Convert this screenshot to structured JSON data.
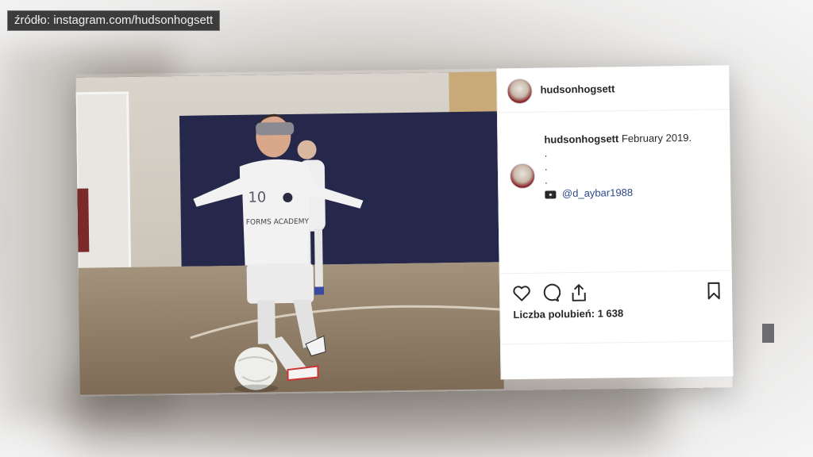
{
  "overlay": {
    "source_label": "źródło: instagram.com/hudsonhogsett"
  },
  "post": {
    "header": {
      "username": "hudsonhogsett"
    },
    "caption": {
      "username": "hudsonhogsett",
      "text": "February 2019.",
      "dots": [
        ".",
        ".",
        "."
      ],
      "mention": "@d_aybar1988",
      "mention_icon": "camera-icon"
    },
    "photo": {
      "jersey_number": "10",
      "jersey_text": "FORMS ACADEMY"
    },
    "actions": {
      "like_icon": "heart-icon",
      "comment_icon": "comment-icon",
      "share_icon": "share-icon",
      "save_icon": "bookmark-icon"
    },
    "likes_text": "Liczba polubień: 1 638"
  },
  "colors": {
    "text": "#262626",
    "mention": "#2a4a8a",
    "label_bg": "#3c3c3c"
  }
}
